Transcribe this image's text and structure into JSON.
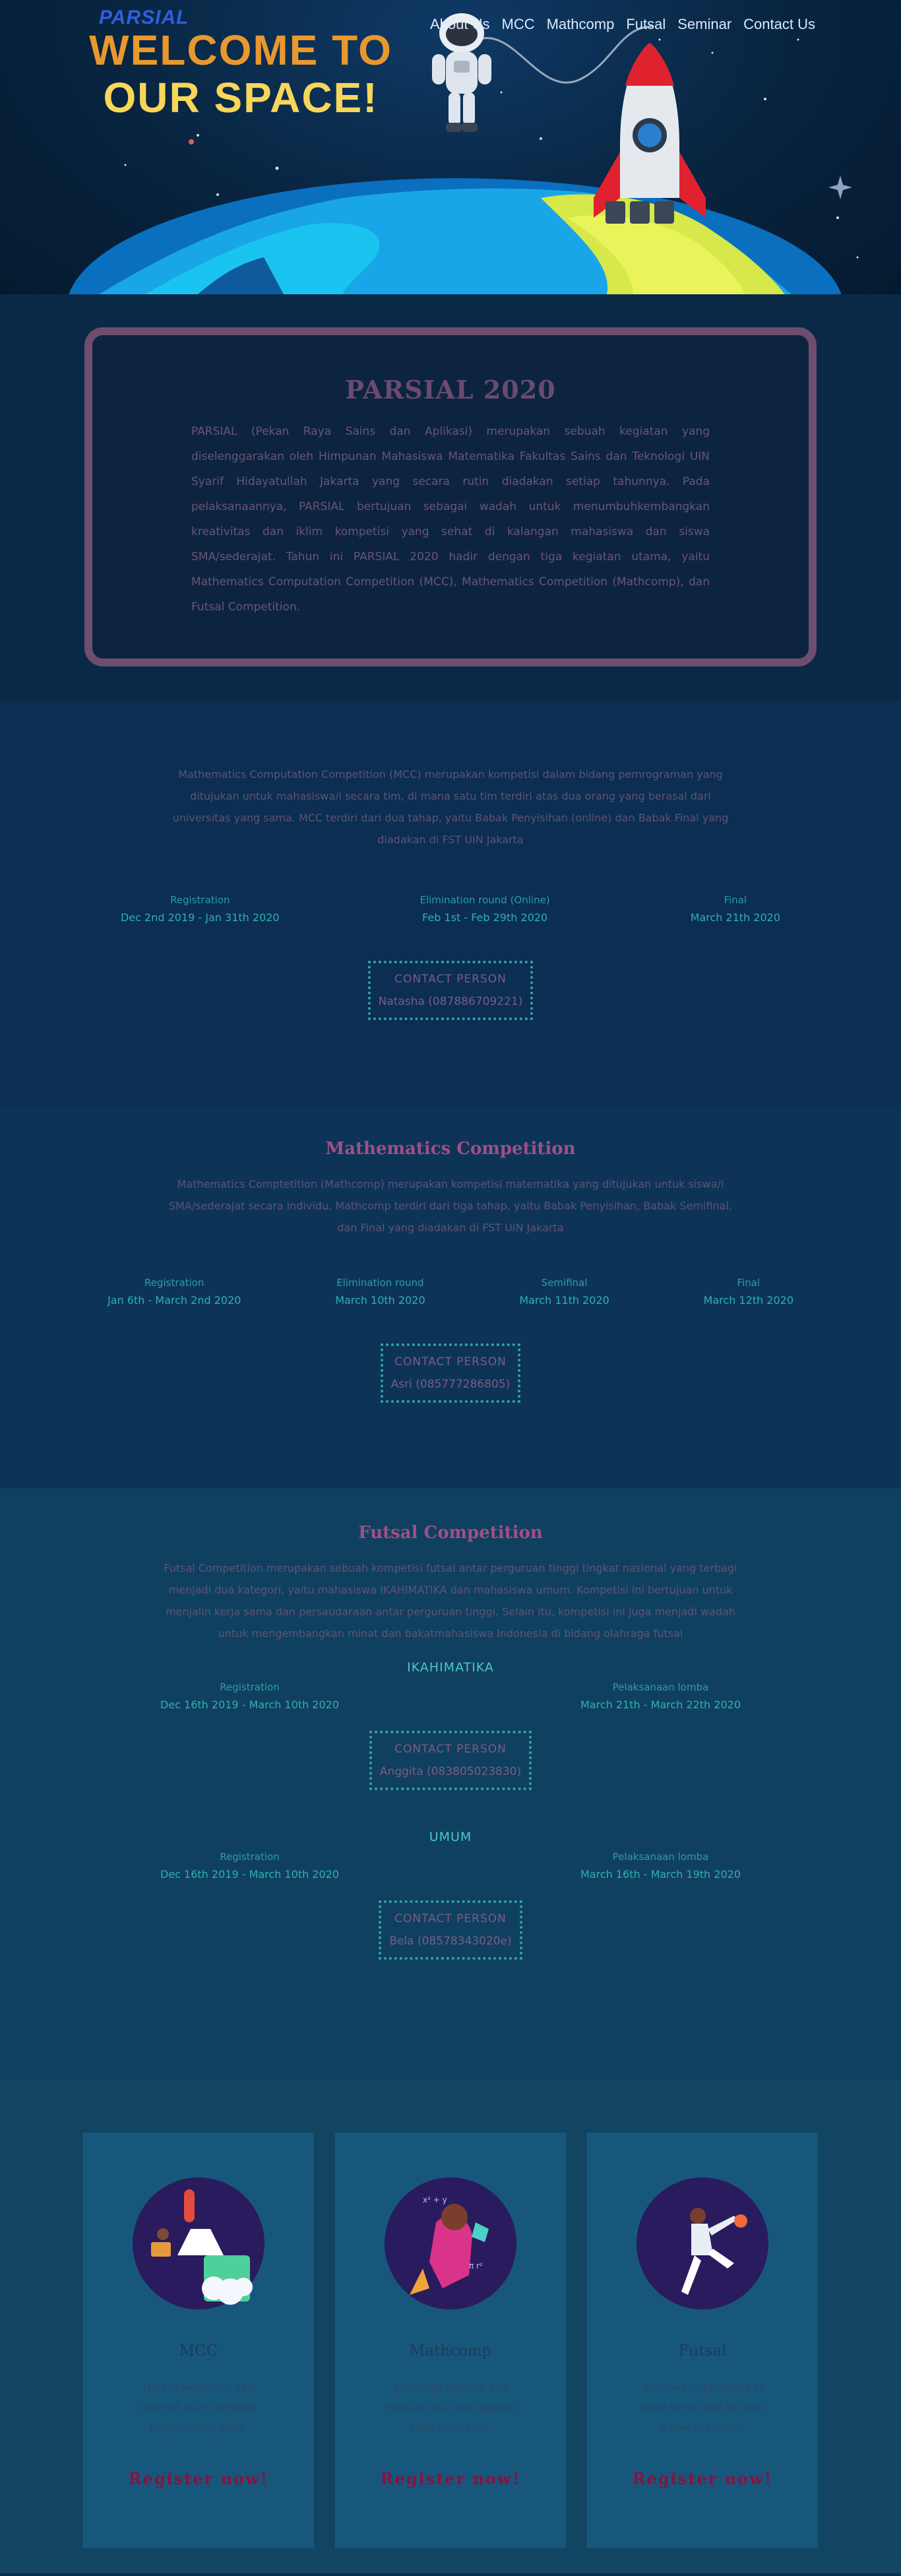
{
  "nav": {
    "logo": "PARSIAL",
    "links": [
      "About Us",
      "MCC",
      "Mathcomp",
      "Futsal",
      "Seminar",
      "Contact Us"
    ]
  },
  "hero": {
    "title_line1": "WELCOME TO",
    "title_line2": "OUR SPACE!"
  },
  "about": {
    "title": "PARSIAL 2020",
    "text": "PARSIAL (Pekan Raya Sains dan Aplikasi) merupakan sebuah kegiatan yang diselenggarakan oleh Himpunan Mahasiswa Matematika Fakultas Sains dan Teknologi UIN Syarif Hidayatullah Jakarta yang secara rutin diadakan setiap tahunnya. Pada pelaksanaannya, PARSIAL bertujuan sebagai wadah untuk menumbuhkembangkan kreativitas dan iklim kompetisi yang sehat di kalangan mahasiswa dan siswa SMA/sederajat. Tahun ini PARSIAL 2020 hadir dengan tiga kegiatan utama, yaitu Mathematics Computation Competition (MCC), Mathematics Competition (Mathcomp), dan Futsal Competition."
  },
  "mcc": {
    "description": "Mathematics Computation Competition (MCC) merupakan kompetisi dalam bidang pemrograman yang ditujukan untuk mahasiswa/i secara tim, di mana satu tim terdiri atas dua orang yang berasal dari universitas yang sama. MCC terdiri dari dua tahap, yaitu Babak Penyisihan (online) dan Babak Final yang diadakan di FST UIN Jakarta",
    "timeline": [
      {
        "label": "Registration",
        "value": "Dec 2nd 2019 - Jan 31th 2020"
      },
      {
        "label": "Elimination round (Online)",
        "value": "Feb 1st - Feb 29th 2020"
      },
      {
        "label": "Final",
        "value": "March 21th 2020"
      }
    ],
    "contact_title": "CONTACT PERSON",
    "contact_value": "Natasha (087886709221)"
  },
  "mathcomp": {
    "title": "Mathematics Competition",
    "description": "Mathematics Comptetition (Mathcomp) merupakan kompetisi matematika yang ditujukan untuk siswa/i SMA/sederajat secara individu. Mathcomp terdiri dari tiga tahap, yaitu Babak Penyisihan, Babak Semifinal, dan Final yang diadakan di FST UIN Jakarta",
    "timeline": [
      {
        "label": "Registration",
        "value": "Jan 6th - March 2nd 2020"
      },
      {
        "label": "Elimination round",
        "value": "March 10th 2020"
      },
      {
        "label": "Semifinal",
        "value": "March 11th 2020"
      },
      {
        "label": "Final",
        "value": "March 12th 2020"
      }
    ],
    "contact_title": "CONTACT PERSON",
    "contact_value": "Asri (085777286805)"
  },
  "futsal": {
    "title": "Futsal Competition",
    "description": "Futsal Competition merupakan sebuah kompetisi futsal antar perguruan tinggi tingkat nasional yang terbagi menjadi dua kategori, yaitu mahasiswa IKAHIMATIKA dan mahasiswa umum. Kompetisi ini bertujuan untuk menjalin kerja sama dan persaudaraan antar perguruan tinggi. Selain itu, kompetisi ini juga menjadi wadah untuk mengembangkan minat dan bakatmahasiswa Indonesia di bidang olahraga futsal",
    "categories": [
      {
        "name": "IKAHIMATIKA",
        "timeline": [
          {
            "label": "Registration",
            "value": "Dec 16th 2019 - March 10th 2020"
          },
          {
            "label": "Pelaksanaan lomba",
            "value": "March 21th - March 22th 2020"
          }
        ],
        "contact_title": "CONTACT PERSON",
        "contact_value": "Anggita (083805023830)"
      },
      {
        "name": "UMUM",
        "timeline": [
          {
            "label": "Registration",
            "value": "Dec 16th 2019 - March 10th 2020"
          },
          {
            "label": "Pelaksanaan lomba",
            "value": "March 16th - March 19th 2020"
          }
        ],
        "contact_title": "CONTACT PERSON",
        "contact_value": "Bela (08578343020e)"
      }
    ]
  },
  "cards": [
    {
      "title": "MCC",
      "text": "Here is where you can show off your computer programming skills.",
      "button": "Register now!"
    },
    {
      "title": "Mathcomp",
      "text": "Challenge yourself and measure your skill against other math fans.",
      "button": "Register now!"
    },
    {
      "title": "Futsal",
      "text": "You have to be united in order to win and become a new champion.",
      "button": "Register now!"
    }
  ],
  "colors": {
    "accent_pink": "#a14f86",
    "teal": "#2fb0b0",
    "register": "#8a1140"
  }
}
